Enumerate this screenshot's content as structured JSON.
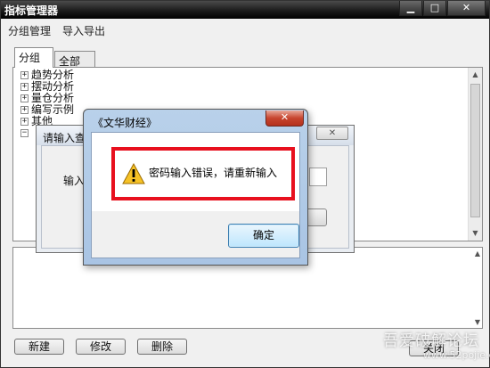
{
  "main_window": {
    "title": "指标管理器",
    "window_buttons": {
      "minimize": "▁",
      "maximize": "□",
      "close": "✕"
    },
    "menu": [
      "分组管理",
      "导入导出"
    ],
    "tabs": [
      "分组",
      "全部"
    ],
    "tree_items": [
      {
        "label": "趋势分析",
        "expander": "+"
      },
      {
        "label": "摆动分析",
        "expander": "+"
      },
      {
        "label": "量仓分析",
        "expander": "+"
      },
      {
        "label": "编写示例",
        "expander": "+"
      },
      {
        "label": "其他",
        "expander": "+"
      },
      {
        "label": "",
        "expander": "−"
      }
    ],
    "buttons": {
      "new": "新建",
      "edit": "修改",
      "delete": "删除",
      "close": "关闭"
    }
  },
  "password_dialog": {
    "title": "请输入查",
    "label": "输入",
    "close_glyph": "✕"
  },
  "message_box": {
    "title": "《文华财经》",
    "close_glyph": "✕",
    "message": "密码输入错误，请重新输入",
    "ok_label": "确定",
    "icon": "warning-icon",
    "highlight_color": "#e8101e"
  },
  "watermark": {
    "text": "吾爱破解论坛",
    "url": "www.52pojie.cn"
  }
}
